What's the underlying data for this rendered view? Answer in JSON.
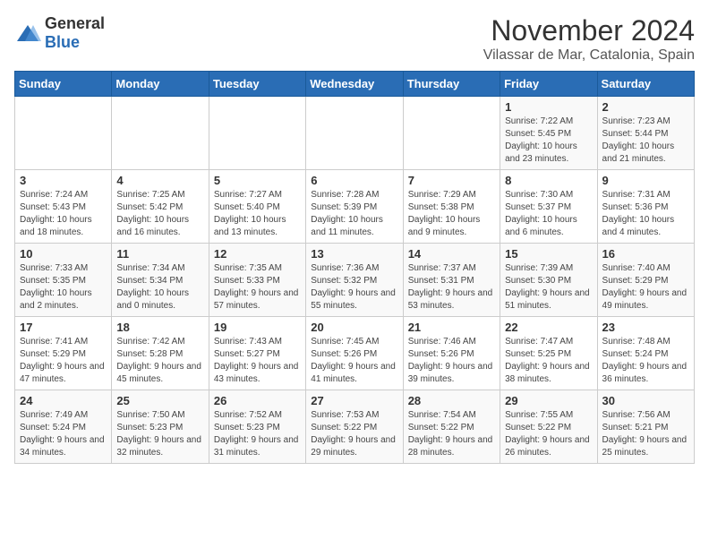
{
  "logo": {
    "general": "General",
    "blue": "Blue"
  },
  "title": "November 2024",
  "location": "Vilassar de Mar, Catalonia, Spain",
  "days_of_week": [
    "Sunday",
    "Monday",
    "Tuesday",
    "Wednesday",
    "Thursday",
    "Friday",
    "Saturday"
  ],
  "weeks": [
    [
      {
        "day": "",
        "info": ""
      },
      {
        "day": "",
        "info": ""
      },
      {
        "day": "",
        "info": ""
      },
      {
        "day": "",
        "info": ""
      },
      {
        "day": "",
        "info": ""
      },
      {
        "day": "1",
        "info": "Sunrise: 7:22 AM\nSunset: 5:45 PM\nDaylight: 10 hours and 23 minutes."
      },
      {
        "day": "2",
        "info": "Sunrise: 7:23 AM\nSunset: 5:44 PM\nDaylight: 10 hours and 21 minutes."
      }
    ],
    [
      {
        "day": "3",
        "info": "Sunrise: 7:24 AM\nSunset: 5:43 PM\nDaylight: 10 hours and 18 minutes."
      },
      {
        "day": "4",
        "info": "Sunrise: 7:25 AM\nSunset: 5:42 PM\nDaylight: 10 hours and 16 minutes."
      },
      {
        "day": "5",
        "info": "Sunrise: 7:27 AM\nSunset: 5:40 PM\nDaylight: 10 hours and 13 minutes."
      },
      {
        "day": "6",
        "info": "Sunrise: 7:28 AM\nSunset: 5:39 PM\nDaylight: 10 hours and 11 minutes."
      },
      {
        "day": "7",
        "info": "Sunrise: 7:29 AM\nSunset: 5:38 PM\nDaylight: 10 hours and 9 minutes."
      },
      {
        "day": "8",
        "info": "Sunrise: 7:30 AM\nSunset: 5:37 PM\nDaylight: 10 hours and 6 minutes."
      },
      {
        "day": "9",
        "info": "Sunrise: 7:31 AM\nSunset: 5:36 PM\nDaylight: 10 hours and 4 minutes."
      }
    ],
    [
      {
        "day": "10",
        "info": "Sunrise: 7:33 AM\nSunset: 5:35 PM\nDaylight: 10 hours and 2 minutes."
      },
      {
        "day": "11",
        "info": "Sunrise: 7:34 AM\nSunset: 5:34 PM\nDaylight: 10 hours and 0 minutes."
      },
      {
        "day": "12",
        "info": "Sunrise: 7:35 AM\nSunset: 5:33 PM\nDaylight: 9 hours and 57 minutes."
      },
      {
        "day": "13",
        "info": "Sunrise: 7:36 AM\nSunset: 5:32 PM\nDaylight: 9 hours and 55 minutes."
      },
      {
        "day": "14",
        "info": "Sunrise: 7:37 AM\nSunset: 5:31 PM\nDaylight: 9 hours and 53 minutes."
      },
      {
        "day": "15",
        "info": "Sunrise: 7:39 AM\nSunset: 5:30 PM\nDaylight: 9 hours and 51 minutes."
      },
      {
        "day": "16",
        "info": "Sunrise: 7:40 AM\nSunset: 5:29 PM\nDaylight: 9 hours and 49 minutes."
      }
    ],
    [
      {
        "day": "17",
        "info": "Sunrise: 7:41 AM\nSunset: 5:29 PM\nDaylight: 9 hours and 47 minutes."
      },
      {
        "day": "18",
        "info": "Sunrise: 7:42 AM\nSunset: 5:28 PM\nDaylight: 9 hours and 45 minutes."
      },
      {
        "day": "19",
        "info": "Sunrise: 7:43 AM\nSunset: 5:27 PM\nDaylight: 9 hours and 43 minutes."
      },
      {
        "day": "20",
        "info": "Sunrise: 7:45 AM\nSunset: 5:26 PM\nDaylight: 9 hours and 41 minutes."
      },
      {
        "day": "21",
        "info": "Sunrise: 7:46 AM\nSunset: 5:26 PM\nDaylight: 9 hours and 39 minutes."
      },
      {
        "day": "22",
        "info": "Sunrise: 7:47 AM\nSunset: 5:25 PM\nDaylight: 9 hours and 38 minutes."
      },
      {
        "day": "23",
        "info": "Sunrise: 7:48 AM\nSunset: 5:24 PM\nDaylight: 9 hours and 36 minutes."
      }
    ],
    [
      {
        "day": "24",
        "info": "Sunrise: 7:49 AM\nSunset: 5:24 PM\nDaylight: 9 hours and 34 minutes."
      },
      {
        "day": "25",
        "info": "Sunrise: 7:50 AM\nSunset: 5:23 PM\nDaylight: 9 hours and 32 minutes."
      },
      {
        "day": "26",
        "info": "Sunrise: 7:52 AM\nSunset: 5:23 PM\nDaylight: 9 hours and 31 minutes."
      },
      {
        "day": "27",
        "info": "Sunrise: 7:53 AM\nSunset: 5:22 PM\nDaylight: 9 hours and 29 minutes."
      },
      {
        "day": "28",
        "info": "Sunrise: 7:54 AM\nSunset: 5:22 PM\nDaylight: 9 hours and 28 minutes."
      },
      {
        "day": "29",
        "info": "Sunrise: 7:55 AM\nSunset: 5:22 PM\nDaylight: 9 hours and 26 minutes."
      },
      {
        "day": "30",
        "info": "Sunrise: 7:56 AM\nSunset: 5:21 PM\nDaylight: 9 hours and 25 minutes."
      }
    ]
  ]
}
